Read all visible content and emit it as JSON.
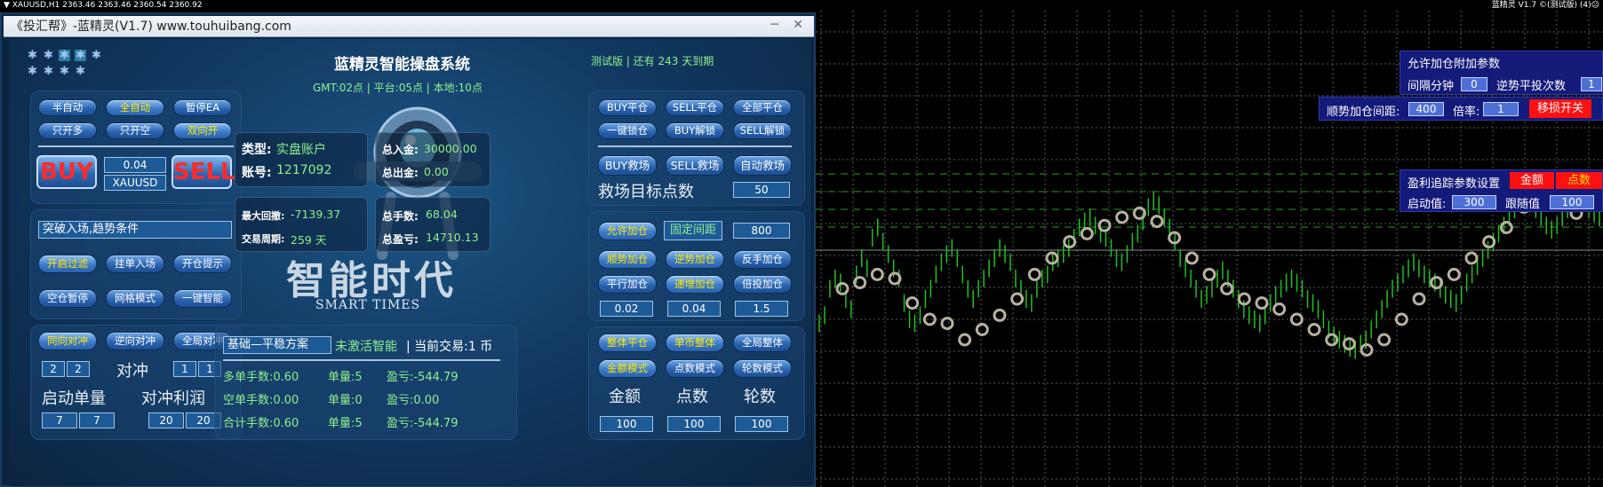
{
  "topbar": {
    "symbol": "▼ XAUUSD,H1  2363.46 2363.46 2360.54 2360.92",
    "right": "蓝精灵 V1.7 ©(测试版)  (4)☺"
  },
  "window": {
    "title": "《投汇帮》-蓝精灵(V1.7) www.touhuibang.com",
    "controls": "─ ✕"
  },
  "header": {
    "title": "蓝精灵智能操盘系统",
    "times": "GMT:02点 | 平台:05点 | 本地:10点",
    "trial": "测试版 | 还有 243 天到期"
  },
  "stars": {
    "glyph": "✱"
  },
  "mode_buttons": {
    "semi_auto": "半自动",
    "full_auto": "全自动",
    "pause_ea": "暂停EA",
    "only_long": "只开多",
    "only_short": "只开空",
    "both": "双向开"
  },
  "trade": {
    "buy": "BUY",
    "sell": "SELL",
    "lot": "0.04",
    "symbol": "XAUUSD"
  },
  "entry": {
    "condition": "突破入场,趋势条件",
    "open_filter": "开启过滤",
    "pending_entry": "挂单入场",
    "open_hint": "开仓提示",
    "empty_pause": "空仓暂停",
    "grid_mode": "网格模式",
    "one_key_smart": "一键智能"
  },
  "hedge": {
    "same_dir": "同向对冲",
    "reverse": "逆向对冲",
    "global": "全局对冲",
    "label_hedge": "对冲",
    "label_start_lot": "启动单量",
    "label_hedge_profit": "对冲利润",
    "v1": "2",
    "v2": "2",
    "v3": "1",
    "v4": "1",
    "v5": "7",
    "v6": "7",
    "v7": "20",
    "v8": "20"
  },
  "account": {
    "type_label": "类型:",
    "type_value": "实盘账户",
    "acct_label": "账号:",
    "acct_value": "1217092",
    "in_label": "总入金:",
    "in_value": "30000.00",
    "out_label": "总出金:",
    "out_value": "0.00",
    "dd_label": "最大回撤:",
    "dd_value": "-7139.37",
    "period_label": "交易周期:",
    "period_value": "259 天",
    "lots_label": "总手数:",
    "lots_value": "68.04",
    "pl_label": "总盈亏:",
    "pl_value": "14710.13"
  },
  "brand": {
    "cn": "智能时代",
    "en": "SMART TIMES"
  },
  "plan": {
    "name": "基础—平稳方案",
    "status": "未激活智能",
    "current": "| 当前交易:1 币"
  },
  "positions": {
    "long": "多单手数:0.60",
    "long_qty": "单量:5",
    "long_pl": "盈亏:-544.79",
    "short": "空单手数:0.00",
    "short_qty": "单量:0",
    "short_pl": "盈亏:0.00",
    "total": "合计手数:0.60",
    "total_qty": "单量:5",
    "total_pl": "盈亏:-544.79"
  },
  "close": {
    "buy_close": "BUY平仓",
    "sell_close": "SELL平仓",
    "all_close": "全部平仓",
    "lock": "一键锁仓",
    "buy_unlock": "BUY解锁",
    "sell_unlock": "SELL解锁",
    "buy_rescue": "BUY救场",
    "sell_rescue": "SELL救场",
    "auto_rescue": "自动救场",
    "rescue_target": "救场目标点数",
    "rescue_value": "50"
  },
  "add": {
    "allow_add": "允许加仓",
    "fixed_spacing": "固定间距",
    "spacing_value": "800",
    "trend_add": "顺势加仓",
    "counter_add": "逆势加仓",
    "reverse_add": "反手加仓",
    "flat_add": "平行加仓",
    "inc_add": "递增加仓",
    "mult_add": "倍投加仓",
    "v1": "0.02",
    "v2": "0.04",
    "v3": "1.5"
  },
  "profit": {
    "total_close": "整体平仓",
    "single_total": "单币整体",
    "global_total": "全局整体",
    "amount_mode": "金额模式",
    "points_mode": "点数模式",
    "rounds_mode": "轮数模式",
    "amount": "金额",
    "points": "点数",
    "rounds": "轮数",
    "v1": "100",
    "v2": "100",
    "v3": "100"
  },
  "overlay": {
    "add_title": "允许加仓附加参数",
    "interval_label": "间隔分钟",
    "interval_value": "0",
    "counter_label": "逆势平投次数",
    "counter_value": "1",
    "trend_spacing_label": "顺势加仓间距:",
    "trend_spacing_value": "400",
    "ratio_label": "倍率:",
    "ratio_value": "1",
    "sl_switch": "移损开关",
    "trail_title": "盈利追踪参数设置",
    "amount_tab": "金额",
    "points_tab": "点数",
    "start_label": "启动值:",
    "start_value": "300",
    "follow_label": "跟随值",
    "follow_value": "100"
  },
  "chart_data": {
    "type": "line",
    "title": "",
    "xlabel": "",
    "ylabel": "",
    "grid": true,
    "legend": "none",
    "y_min": 0,
    "y_max": 100,
    "values": [
      38,
      42,
      55,
      60,
      58,
      50,
      45,
      62,
      70,
      65,
      80,
      85,
      78,
      72,
      65,
      60,
      48,
      40,
      38,
      42,
      50,
      55,
      62,
      68,
      72,
      75,
      70,
      62,
      55,
      50,
      55,
      60,
      65,
      70,
      75,
      72,
      68,
      60,
      55,
      50,
      48,
      55,
      60,
      62,
      68,
      70,
      72,
      75,
      80,
      85,
      88,
      90,
      86,
      82,
      80,
      75,
      70,
      68,
      72,
      78,
      82,
      88,
      95,
      98,
      96,
      90,
      85,
      78,
      70,
      65,
      60,
      55,
      50,
      52,
      55,
      60,
      64,
      60,
      55,
      50,
      45,
      42,
      40,
      38,
      42,
      48,
      52,
      55,
      58,
      60,
      58,
      55,
      50,
      48,
      45,
      40,
      35,
      32,
      30,
      28,
      26,
      25,
      28,
      30,
      35,
      40,
      45,
      50,
      55,
      58,
      62,
      65,
      68,
      65,
      62,
      60,
      58,
      55,
      52,
      50,
      48,
      52,
      58,
      62,
      66,
      70,
      74,
      78,
      82,
      86,
      90,
      94,
      98,
      100,
      98,
      94,
      90,
      86,
      84,
      86,
      90,
      94,
      98,
      100,
      97,
      94,
      92,
      90
    ],
    "markers": [
      55,
      58,
      62,
      60,
      48,
      40,
      38,
      30,
      35,
      42,
      50,
      62,
      70,
      78,
      82,
      86,
      90,
      92,
      88,
      80,
      70,
      62,
      55,
      50,
      48,
      45,
      40,
      35,
      30,
      28,
      25,
      30,
      40,
      50,
      58,
      62,
      70,
      78,
      85,
      95,
      100,
      98,
      92
    ]
  }
}
